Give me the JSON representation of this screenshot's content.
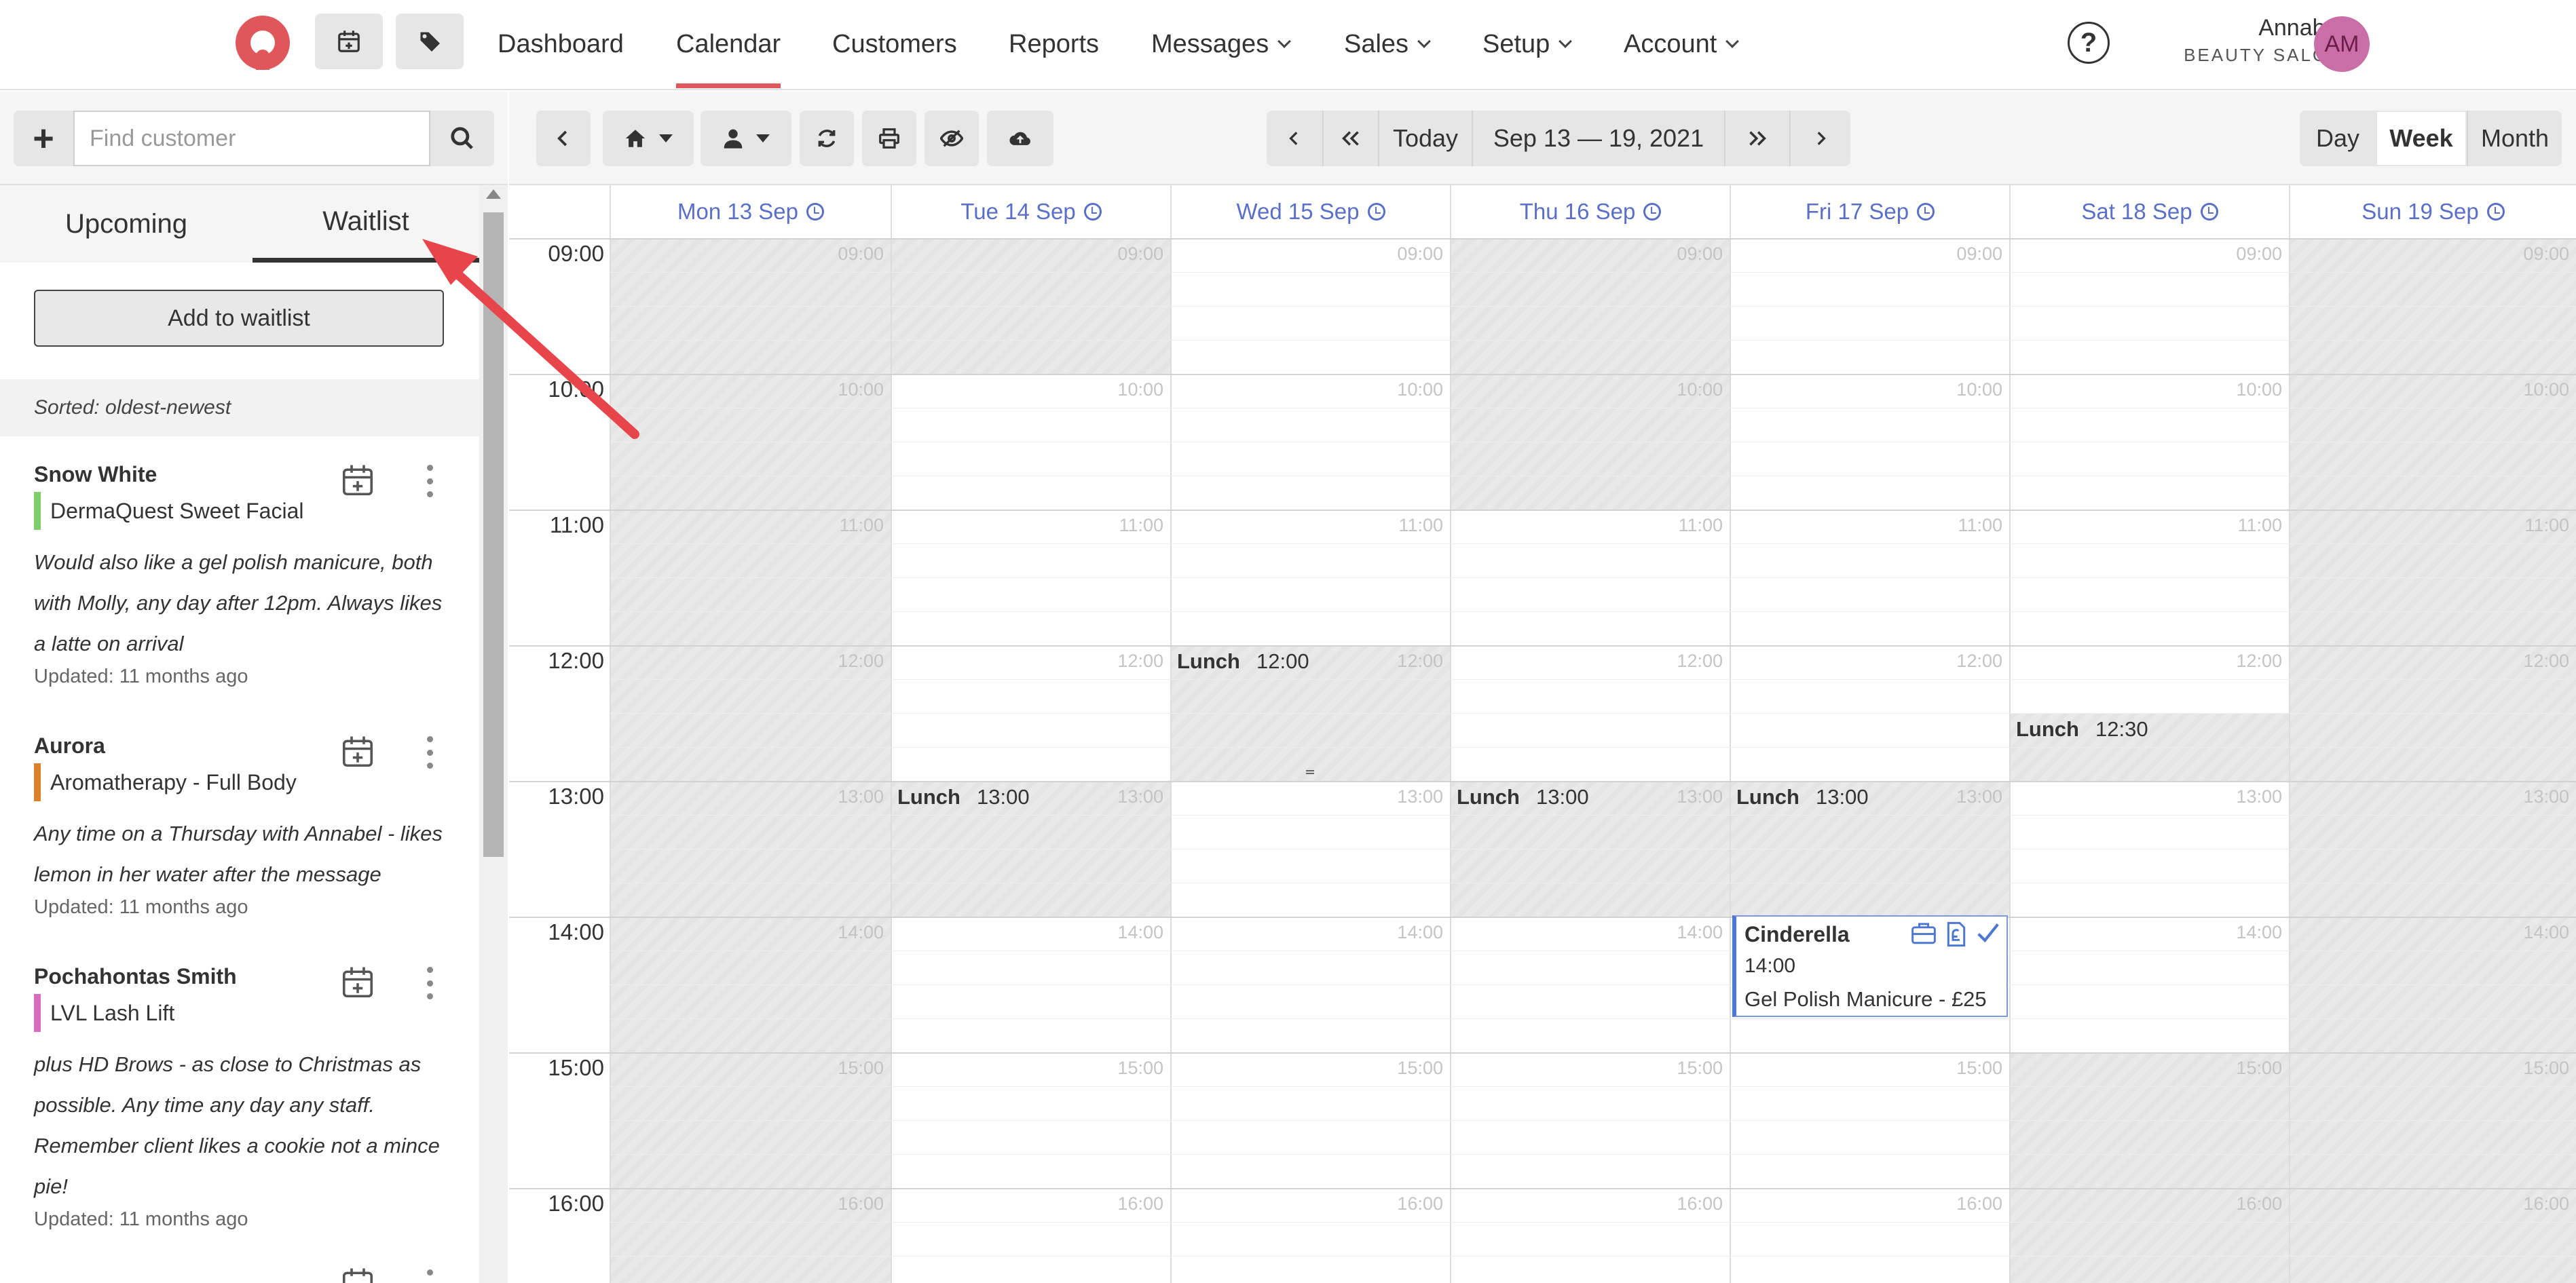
{
  "nav": {
    "items": [
      {
        "label": "Dashboard"
      },
      {
        "label": "Calendar"
      },
      {
        "label": "Customers"
      },
      {
        "label": "Reports"
      },
      {
        "label": "Messages"
      },
      {
        "label": "Sales"
      },
      {
        "label": "Setup"
      },
      {
        "label": "Account"
      }
    ],
    "help": "?",
    "user_name": "Annabel",
    "user_role": "BEAUTY SALON",
    "avatar_initials": "AM"
  },
  "left": {
    "search_placeholder": "Find customer",
    "add_icon": "+",
    "tabs": [
      {
        "label": "Upcoming"
      },
      {
        "label": "Waitlist"
      }
    ],
    "add_to_waitlist": "Add to waitlist",
    "sorted": "Sorted: oldest-newest",
    "entries": [
      {
        "name": "Snow White",
        "service": "DermaQuest Sweet Facial",
        "service_color": "#7ccf6c",
        "note": "Would also like a gel polish manicure, both with Molly, any day after 12pm. Always likes a latte on arrival",
        "updated": "Updated: 11 months ago"
      },
      {
        "name": "Aurora",
        "service": "Aromatherapy - Full Body",
        "service_color": "#d9822b",
        "note": "Any time on a Thursday with Annabel - likes lemon in her water after the message",
        "updated": "Updated: 11 months ago"
      },
      {
        "name": "Pochahontas Smith",
        "service": "LVL Lash Lift",
        "service_color": "#d96bbd",
        "note": "plus HD Brows - as close to Christmas as possible. Any time any day any staff. Remember client likes a cookie not a mince pie!",
        "updated": "Updated: 11 months ago"
      }
    ]
  },
  "toolbar": {
    "today": "Today",
    "date_range": "Sep 13 — 19, 2021",
    "views": [
      {
        "label": "Day"
      },
      {
        "label": "Week"
      },
      {
        "label": "Month"
      }
    ],
    "active_view": "Week"
  },
  "calendar": {
    "days": [
      {
        "label": "Mon 13 Sep"
      },
      {
        "label": "Tue 14 Sep"
      },
      {
        "label": "Wed 15 Sep"
      },
      {
        "label": "Thu 16 Sep"
      },
      {
        "label": "Fri 17 Sep"
      },
      {
        "label": "Sat 18 Sep"
      },
      {
        "label": "Sun 19 Sep"
      }
    ],
    "hours": [
      "09:00",
      "10:00",
      "11:00",
      "12:00",
      "13:00",
      "14:00",
      "15:00",
      "16:00"
    ],
    "lunch_label": "Lunch",
    "lunches": [
      {
        "day": 2,
        "time": "12:00"
      },
      {
        "day": 5,
        "time": "12:30"
      },
      {
        "day": 1,
        "time": "13:00"
      },
      {
        "day": 3,
        "time": "13:00"
      },
      {
        "day": 4,
        "time": "13:00"
      }
    ],
    "appointment": {
      "customer": "Cinderella",
      "time": "14:00",
      "service": "Gel Polish Manicure - £25"
    }
  },
  "colors": {
    "accent": "#e0575b",
    "day_header": "#5a6fc7",
    "appointment_border": "#4d78d0",
    "arrow": "#e8454a"
  }
}
